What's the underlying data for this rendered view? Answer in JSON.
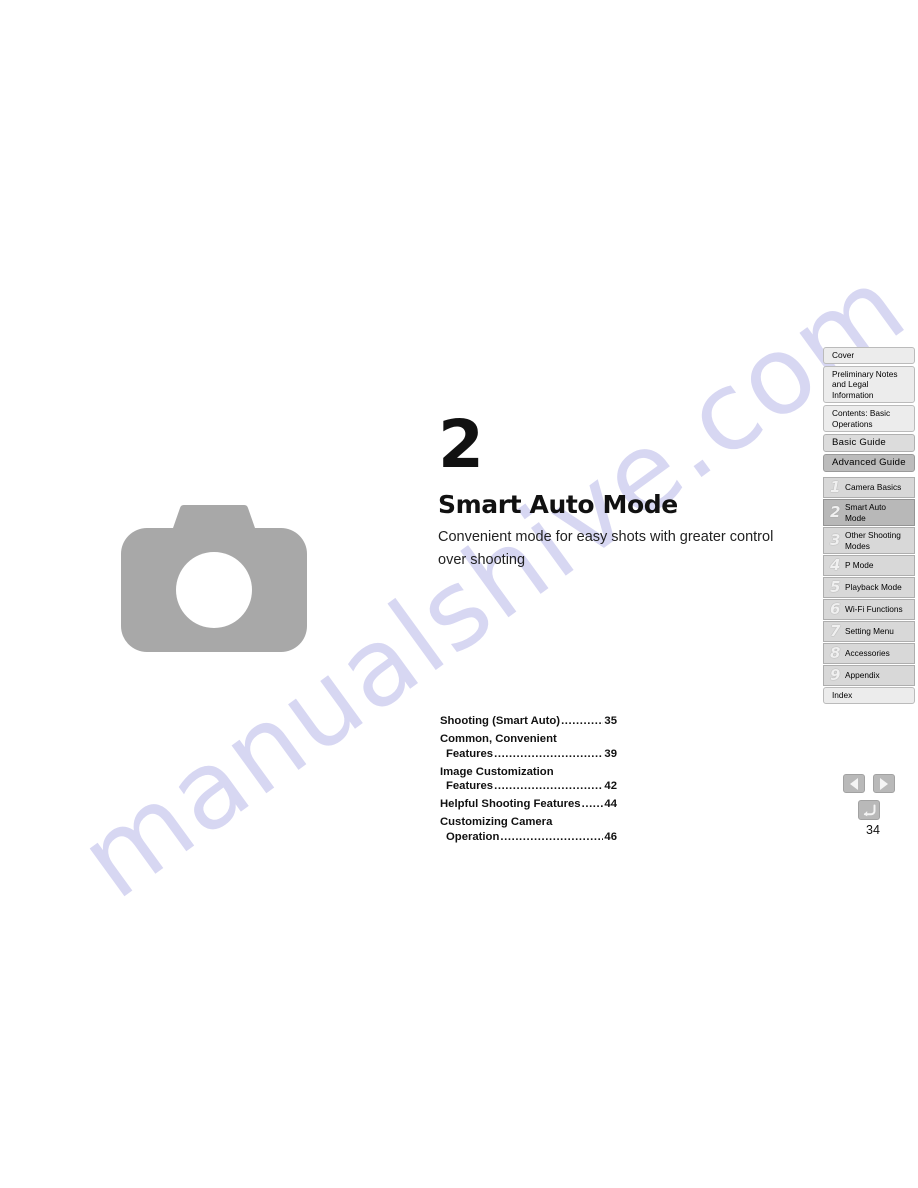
{
  "watermark": {
    "text": "manualshive.com"
  },
  "chapter": {
    "number": "2",
    "title": "Smart Auto Mode",
    "description": "Convenient mode for easy shots with greater control over shooting"
  },
  "illustration": {
    "icon": "camera-icon",
    "color": "#a8a8a8"
  },
  "toc": {
    "entries": [
      {
        "lines": [
          "Shooting (Smart Auto)"
        ],
        "page": "35",
        "wrapped": false
      },
      {
        "lines": [
          "Common, Convenient",
          "Features"
        ],
        "page": "39",
        "wrapped": true
      },
      {
        "lines": [
          "Image Customization",
          "Features"
        ],
        "page": "42",
        "wrapped": true
      },
      {
        "lines": [
          "Helpful Shooting Features "
        ],
        "page": "44",
        "wrapped": false
      },
      {
        "lines": [
          "Customizing Camera",
          "Operation"
        ],
        "page": "46",
        "wrapped": true
      }
    ]
  },
  "sidebar": {
    "items": [
      {
        "label": "Cover",
        "num": "",
        "style": "light",
        "active": false
      },
      {
        "label": "Preliminary Notes and Legal Information",
        "num": "",
        "style": "light",
        "active": false
      },
      {
        "label": "Contents: Basic Operations",
        "num": "",
        "style": "light",
        "active": false
      },
      {
        "label": "Basic Guide",
        "num": "",
        "style": "medium",
        "active": false
      },
      {
        "label": "Advanced Guide",
        "num": "",
        "style": "strong",
        "active": false
      },
      {
        "label": "Camera Basics",
        "num": "1",
        "style": "chapter",
        "active": false
      },
      {
        "label": "Smart Auto Mode",
        "num": "2",
        "style": "chapter",
        "active": true
      },
      {
        "label": "Other Shooting Modes",
        "num": "3",
        "style": "chapter",
        "active": false
      },
      {
        "label": "P Mode",
        "num": "4",
        "style": "chapter",
        "active": false
      },
      {
        "label": "Playback Mode",
        "num": "5",
        "style": "chapter",
        "active": false
      },
      {
        "label": "Wi-Fi Functions",
        "num": "6",
        "style": "chapter",
        "active": false
      },
      {
        "label": "Setting Menu",
        "num": "7",
        "style": "chapter",
        "active": false
      },
      {
        "label": "Accessories",
        "num": "8",
        "style": "chapter",
        "active": false
      },
      {
        "label": "Appendix",
        "num": "9",
        "style": "chapter",
        "active": false
      },
      {
        "label": "Index",
        "num": "",
        "style": "light",
        "active": false
      }
    ]
  },
  "page_nav": {
    "prev_icon": "previous-page-icon",
    "next_icon": "next-page-icon",
    "back_icon": "return-back-icon",
    "page_number": "34"
  }
}
